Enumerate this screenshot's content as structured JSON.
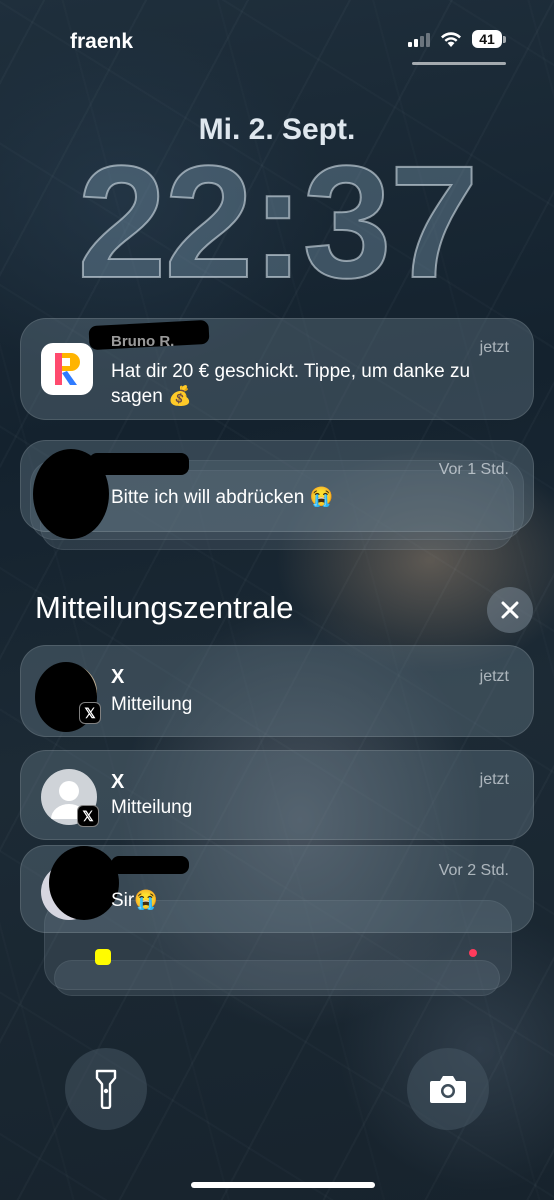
{
  "status_bar": {
    "carrier": "fraenk",
    "battery": "41"
  },
  "lockscreen": {
    "date": "Mi. 2. Sept.",
    "time": "22:37"
  },
  "notifications": [
    {
      "title": "Bruno R.",
      "time": "jetzt",
      "body": "Hat dir 20 € geschickt. Tippe, um danke zu sagen 💰",
      "icon": "app-r-icon"
    },
    {
      "title": "",
      "time": "Vor 1 Std.",
      "body": "Bitte ich will abdrücken 😭"
    }
  ],
  "notification_center": {
    "title": "Mitteilungszentrale",
    "items": [
      {
        "title": "X",
        "time": "jetzt",
        "body": "Mitteilung",
        "badge": "𝕏"
      },
      {
        "title": "X",
        "time": "jetzt",
        "body": "Mitteilung",
        "badge": "𝕏"
      },
      {
        "title": "",
        "time": "Vor 2 Std.",
        "body": "Sir😭"
      }
    ]
  },
  "colors": {
    "accent_glass": "#69808c",
    "text": "#ffffff"
  }
}
